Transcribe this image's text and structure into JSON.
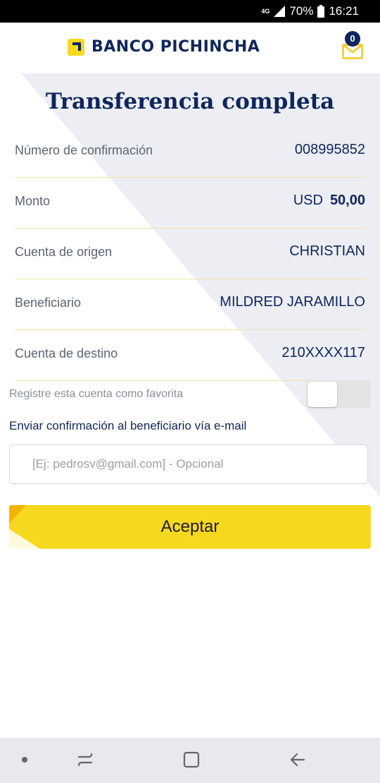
{
  "status_bar": {
    "network": "4G",
    "battery_percent": "70%",
    "time": "16:21"
  },
  "header": {
    "brand": "BANCO PICHINCHA",
    "mail_count": "0"
  },
  "title": "Transferencia completa",
  "details": [
    {
      "label": "Número de confirmación",
      "value": "008995852"
    },
    {
      "label": "Monto",
      "currency": "USD",
      "amount": "50,00"
    },
    {
      "label": "Cuenta de origen",
      "value": "CHRISTIAN"
    },
    {
      "label": "Beneficiario",
      "value": "MILDRED JARAMILLO"
    },
    {
      "label": "Cuenta de destino",
      "value": "210XXXX117"
    }
  ],
  "favorite": {
    "label": "Registre esta cuenta como favorita",
    "enabled": false
  },
  "email": {
    "label": "Enviar confirmación al beneficiario vía e-mail",
    "placeholder": "[Ej: pedrosv@gmail.com] - Opcional",
    "value": ""
  },
  "accept_button": {
    "label": "Aceptar"
  },
  "colors": {
    "navy": "#0f265c",
    "yellow": "#f6d91f",
    "divider": "#f0e3a6"
  },
  "nav_icons": [
    "dot-icon",
    "recent-apps-icon",
    "home-icon",
    "back-icon"
  ]
}
